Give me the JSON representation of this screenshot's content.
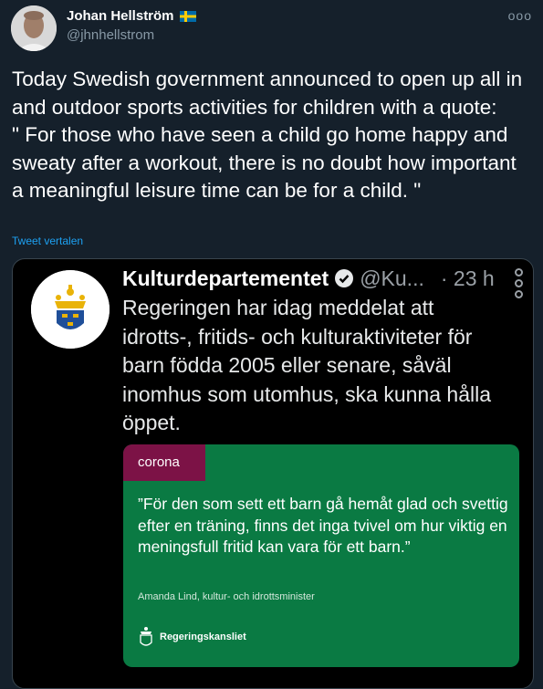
{
  "author": {
    "name": "Johan Hellström",
    "handle": "@jhnhellstrom",
    "flag_icon": "swedish-flag-icon"
  },
  "tweet": {
    "text": "Today Swedish government announced to open up all in and outdoor sports activities for children with a quote:\n\" For those who have seen a child go home happy and sweaty after a workout, there is no doubt how important a meaningful leisure time can be for a child. \"",
    "translate_label": "Tweet vertalen"
  },
  "more_menu": "ooo",
  "embedded": {
    "name": "Kulturdepartementet",
    "handle": "@Ku...",
    "time": "· 23 h",
    "text": "Regeringen har idag meddelat att idrotts-, fritids- och kulturaktiviteter för barn födda 2005 eller senare, såväl inomhus som utomhus, ska kunna hålla öppet.",
    "card": {
      "tag": "corona",
      "quote": "”För den som sett ett barn gå hemåt glad och svettig efter en träning, finns det inga tvivel om hur viktig en meningsfull fritid kan vara för ett barn.”",
      "attribution": "Amanda Lind, kultur- och idrottsminister",
      "logo_text": "Regeringskansliet"
    }
  },
  "colors": {
    "background": "#15202b",
    "card_green": "#0a7a43",
    "tag_maroon": "#7c1246",
    "link_blue": "#1da1f2"
  }
}
